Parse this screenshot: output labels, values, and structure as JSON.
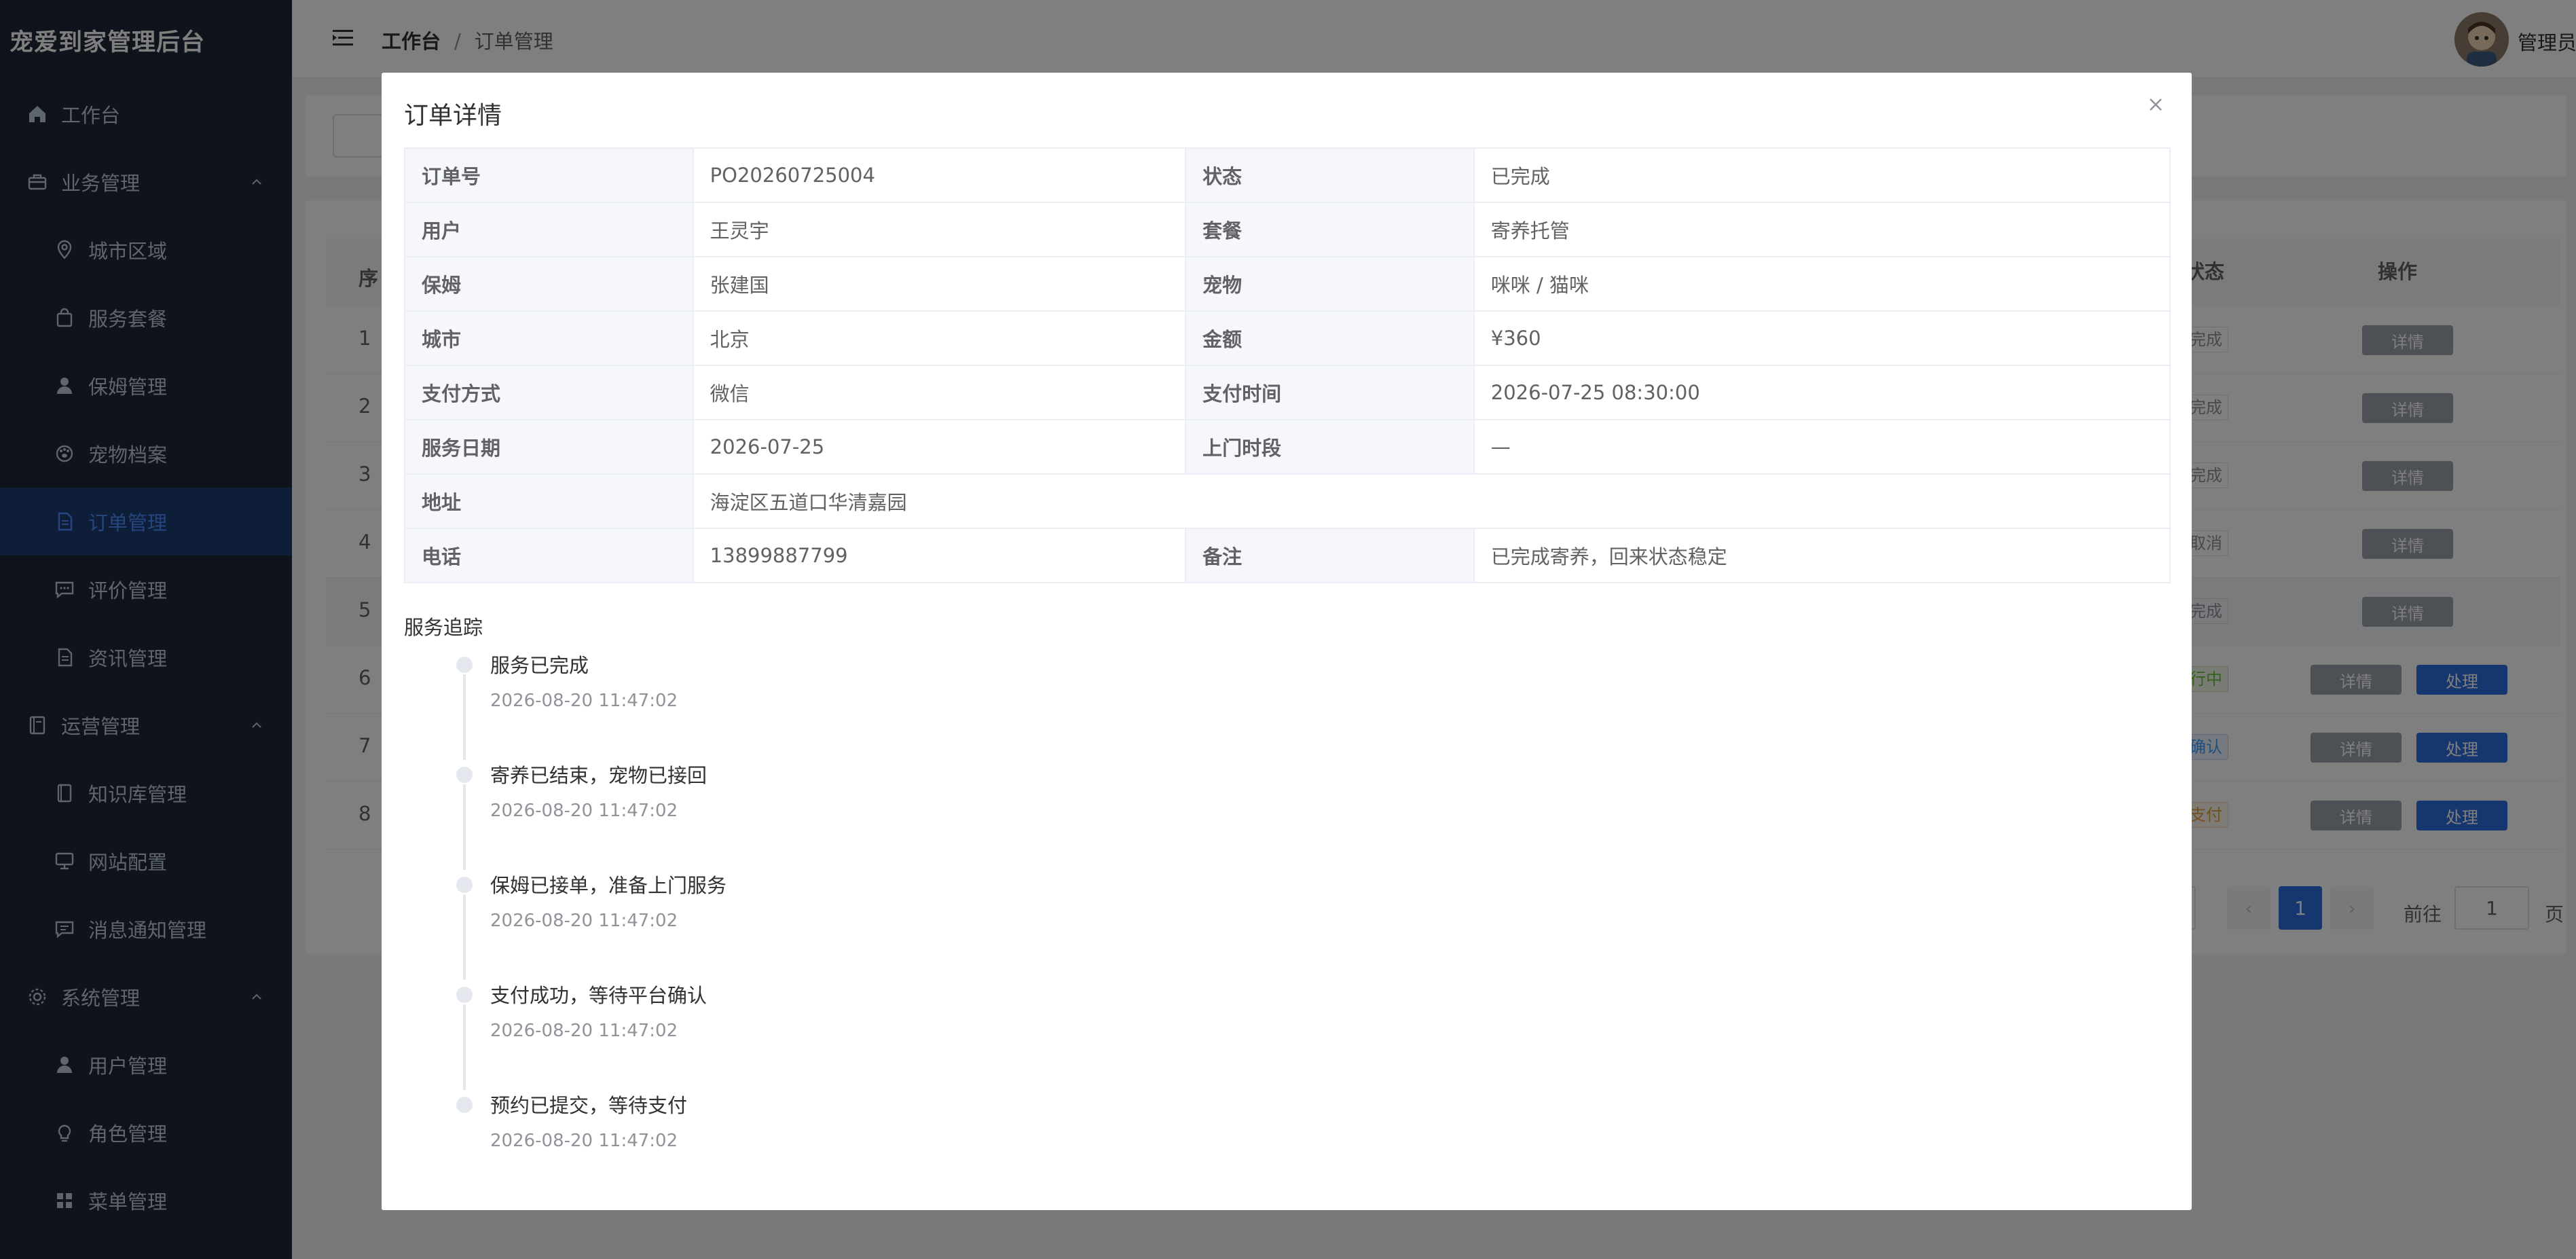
{
  "app": {
    "brand": "宠爱到家管理后台"
  },
  "sidebar": {
    "items": [
      {
        "label": "工作台",
        "icon": "home-icon",
        "level": "top"
      },
      {
        "label": "业务管理",
        "icon": "briefcase-icon",
        "level": "top",
        "expanded": true
      },
      {
        "label": "城市区域",
        "icon": "location-icon",
        "level": "sub"
      },
      {
        "label": "服务套餐",
        "icon": "bag-icon",
        "level": "sub"
      },
      {
        "label": "保姆管理",
        "icon": "user-icon",
        "level": "sub"
      },
      {
        "label": "宠物档案",
        "icon": "paw-icon",
        "level": "sub"
      },
      {
        "label": "订单管理",
        "icon": "document-icon",
        "level": "sub",
        "active": true
      },
      {
        "label": "评价管理",
        "icon": "chat-icon",
        "level": "sub"
      },
      {
        "label": "资讯管理",
        "icon": "document-icon",
        "level": "sub"
      },
      {
        "label": "运营管理",
        "icon": "notebook-icon",
        "level": "top",
        "expanded": true
      },
      {
        "label": "知识库管理",
        "icon": "book-icon",
        "level": "sub"
      },
      {
        "label": "网站配置",
        "icon": "monitor-icon",
        "level": "sub"
      },
      {
        "label": "消息通知管理",
        "icon": "message-icon",
        "level": "sub"
      },
      {
        "label": "系统管理",
        "icon": "gear-icon",
        "level": "top",
        "expanded": true
      },
      {
        "label": "用户管理",
        "icon": "user-icon",
        "level": "sub"
      },
      {
        "label": "角色管理",
        "icon": "bulb-icon",
        "level": "sub"
      },
      {
        "label": "菜单管理",
        "icon": "grid-icon",
        "level": "sub"
      }
    ]
  },
  "header": {
    "breadcrumb": [
      "工作台",
      "订单管理"
    ],
    "separator": "/",
    "user": "管理员"
  },
  "background_table": {
    "status_header": "状态",
    "ops_header": "操作",
    "left_header": "序",
    "rows": [
      {
        "idx": "1",
        "status": "完成",
        "status_color": "gray",
        "actions": [
          "详情"
        ]
      },
      {
        "idx": "2",
        "status": "完成",
        "status_color": "gray",
        "actions": [
          "详情"
        ]
      },
      {
        "idx": "3",
        "status": "完成",
        "status_color": "gray",
        "actions": [
          "详情"
        ]
      },
      {
        "idx": "4",
        "status": "取消",
        "status_color": "gray",
        "actions": [
          "详情"
        ]
      },
      {
        "idx": "5",
        "status": "完成",
        "status_color": "gray",
        "actions": [
          "详情"
        ]
      },
      {
        "idx": "6",
        "status": "行中",
        "status_color": "green",
        "actions": [
          "详情",
          "处理"
        ]
      },
      {
        "idx": "7",
        "status": "确认",
        "status_color": "blue",
        "actions": [
          "详情",
          "处理"
        ]
      },
      {
        "idx": "8",
        "status": "支付",
        "status_color": "orange",
        "actions": [
          "详情",
          "处理"
        ]
      }
    ],
    "pager": {
      "current": "1",
      "goto_label": "前往",
      "goto_value": "1",
      "page_label": "页",
      "prev": "‹",
      "next": "›"
    }
  },
  "dialog": {
    "title": "订单详情",
    "close_icon": "close-icon",
    "details": {
      "order_no_label": "订单号",
      "order_no": "PO20260725004",
      "status_label": "状态",
      "status": "已完成",
      "user_label": "用户",
      "user": "王灵宇",
      "package_label": "套餐",
      "package": "寄养托管",
      "nanny_label": "保姆",
      "nanny": "张建国",
      "pet_label": "宠物",
      "pet": "咪咪 / 猫咪",
      "city_label": "城市",
      "city": "北京",
      "amount_label": "金额",
      "amount": "¥360",
      "pay_method_label": "支付方式",
      "pay_method": "微信",
      "pay_time_label": "支付时间",
      "pay_time": "2026-07-25 08:30:00",
      "service_date_label": "服务日期",
      "service_date": "2026-07-25",
      "visit_slot_label": "上门时段",
      "visit_slot": "—",
      "address_label": "地址",
      "address": "海淀区五道口华清嘉园",
      "phone_label": "电话",
      "phone": "13899887799",
      "remark_label": "备注",
      "remark": "已完成寄养，回来状态稳定"
    },
    "tracking_title": "服务追踪",
    "tracking": [
      {
        "text": "服务已完成",
        "time": "2026-08-20 11:47:02"
      },
      {
        "text": "寄养已结束，宠物已接回",
        "time": "2026-08-20 11:47:02"
      },
      {
        "text": "保姆已接单，准备上门服务",
        "time": "2026-08-20 11:47:02"
      },
      {
        "text": "支付成功，等待平台确认",
        "time": "2026-08-20 11:47:02"
      },
      {
        "text": "预约已提交，等待支付",
        "time": "2026-08-20 11:47:02"
      }
    ]
  },
  "colors": {
    "sidebar_bg": "#1f2637",
    "accent": "#2d6cdf",
    "active_item_bg": "#1e3c70"
  }
}
